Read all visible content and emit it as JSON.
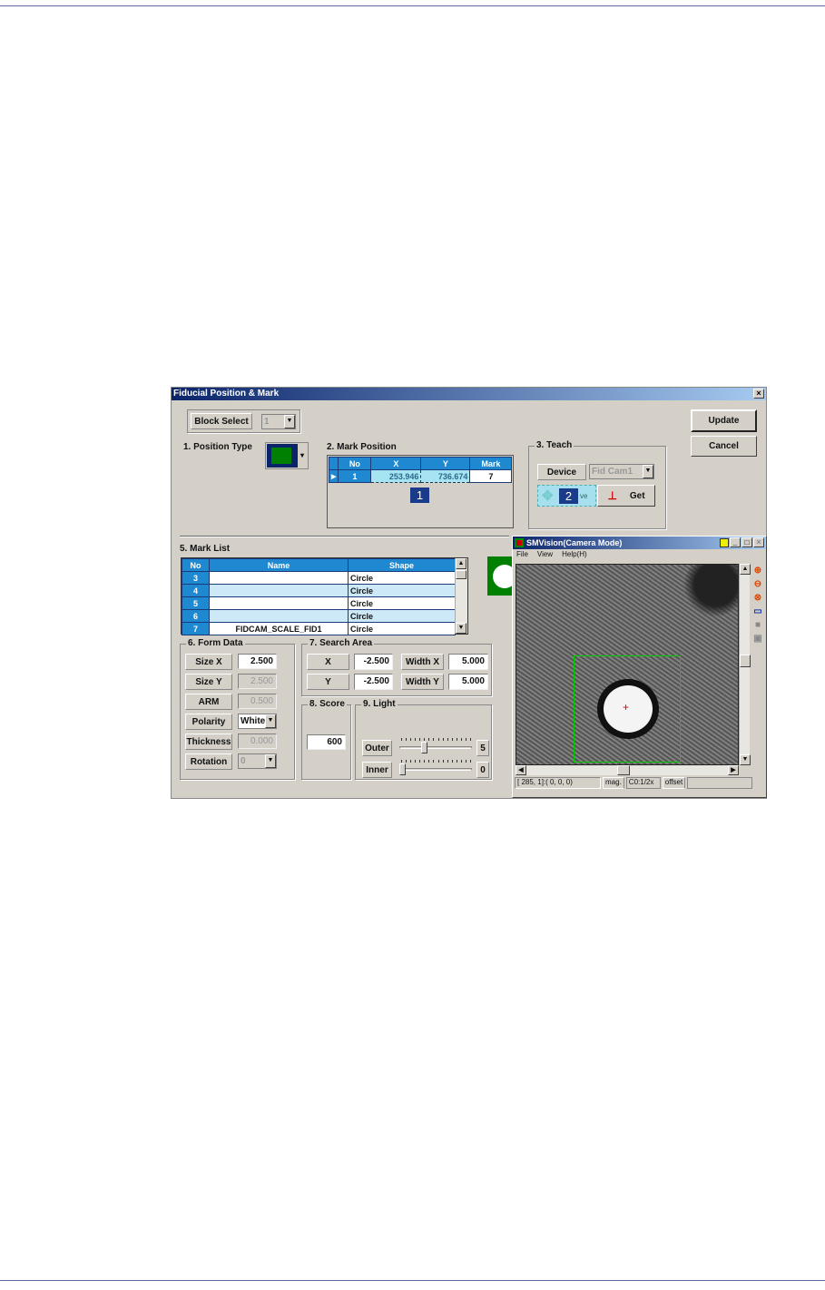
{
  "dialog": {
    "title": "Fiducial Position & Mark",
    "close": "×",
    "block_select_label": "Block Select",
    "block_select_value": "1",
    "update": "Update",
    "cancel": "Cancel",
    "position_type_label": "1. Position Type",
    "mark_position": {
      "label": "2. Mark Position",
      "headers": [
        "No",
        "X",
        "Y",
        "Mark"
      ],
      "row": {
        "no": "1",
        "x": "253.946",
        "y": "736.674",
        "mark": "7"
      },
      "callout": "1"
    },
    "teach": {
      "label": "3. Teach",
      "device": "Device",
      "device_value": "Fid Cam1",
      "move_callout": "2",
      "move_suffix": "ve",
      "get": "Get"
    },
    "mark_list": {
      "label": "5. Mark List",
      "headers": [
        "No",
        "Name",
        "Shape"
      ],
      "rows": [
        {
          "no": "3",
          "name": "",
          "shape": "Circle"
        },
        {
          "no": "4",
          "name": "",
          "shape": "Circle"
        },
        {
          "no": "5",
          "name": "",
          "shape": "Circle"
        },
        {
          "no": "6",
          "name": "",
          "shape": "Circle"
        },
        {
          "no": "7",
          "name": "FIDCAM_SCALE_FID1",
          "shape": "Circle"
        }
      ]
    },
    "form_data": {
      "label": "6. Form Data",
      "rows": [
        {
          "label": "Size X",
          "value": "2.500"
        },
        {
          "label": "Size Y",
          "value": "2.500"
        },
        {
          "label": "ARM",
          "value": "0.500"
        },
        {
          "label": "Polarity",
          "value": "White"
        },
        {
          "label": "Thickness",
          "value": "0.000"
        },
        {
          "label": "Rotation",
          "value": "0"
        }
      ]
    },
    "search_area": {
      "label": "7. Search Area",
      "x_label": "X",
      "x": "-2.500",
      "y_label": "Y",
      "y": "-2.500",
      "wx_label": "Width X",
      "wx": "5.000",
      "wy_label": "Width Y",
      "wy": "5.000"
    },
    "score": {
      "label": "8. Score",
      "value": "600"
    },
    "light": {
      "label": "9. Light",
      "outer_label": "Outer",
      "outer": "5",
      "inner_label": "Inner",
      "inner": "0",
      "max": 15
    }
  },
  "camera": {
    "title": "SMVision(Camera Mode)",
    "menu": [
      "File",
      "View",
      "Help(H)"
    ],
    "status": [
      "[ 285,  1]:( 0,  0,  0)",
      "mag.",
      "C0:1/2x",
      "offset"
    ]
  },
  "colors": {
    "title": "#0a246a",
    "header": "#1e88d0",
    "fid_green": "#008000"
  }
}
